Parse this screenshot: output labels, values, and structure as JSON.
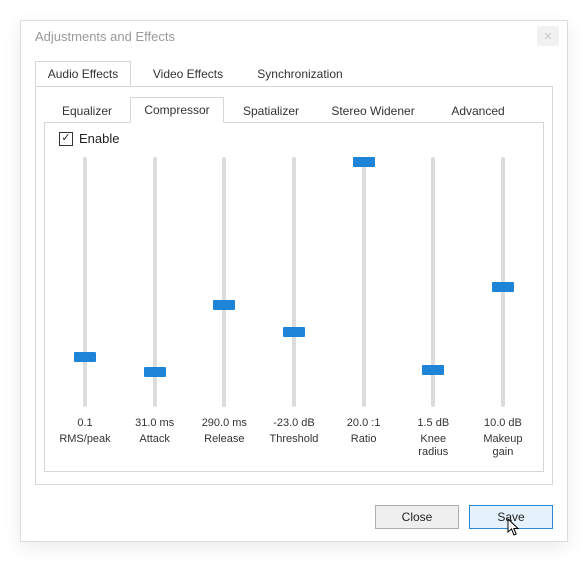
{
  "window": {
    "title": "Adjustments and Effects",
    "close_glyph": "✕"
  },
  "tabs": {
    "audio": "Audio Effects",
    "video": "Video Effects",
    "sync": "Synchronization"
  },
  "subtabs": {
    "equalizer": "Equalizer",
    "compressor": "Compressor",
    "spatializer": "Spatializer",
    "stereo": "Stereo Widener",
    "advanced": "Advanced"
  },
  "compressor": {
    "enable_label": "Enable",
    "enable_checked": true,
    "check_glyph": "✓",
    "sliders": {
      "rmspeak": {
        "value": "0.1",
        "label": "RMS/peak",
        "pos": 0.2
      },
      "attack": {
        "value": "31.0 ms",
        "label": "Attack",
        "pos": 0.14
      },
      "release": {
        "value": "290.0 ms",
        "label": "Release",
        "pos": 0.41
      },
      "threshold": {
        "value": "-23.0 dB",
        "label": "Threshold",
        "pos": 0.3
      },
      "ratio": {
        "value": "20.0 :1",
        "label": "Ratio",
        "pos": 0.98
      },
      "knee": {
        "value": "1.5 dB",
        "label": "Knee\nradius",
        "pos": 0.15
      },
      "makeup": {
        "value": "10.0 dB",
        "label": "Makeup\ngain",
        "pos": 0.48
      }
    }
  },
  "footer": {
    "close": "Close",
    "save": "Save"
  },
  "colors": {
    "accent": "#1e84d8"
  }
}
